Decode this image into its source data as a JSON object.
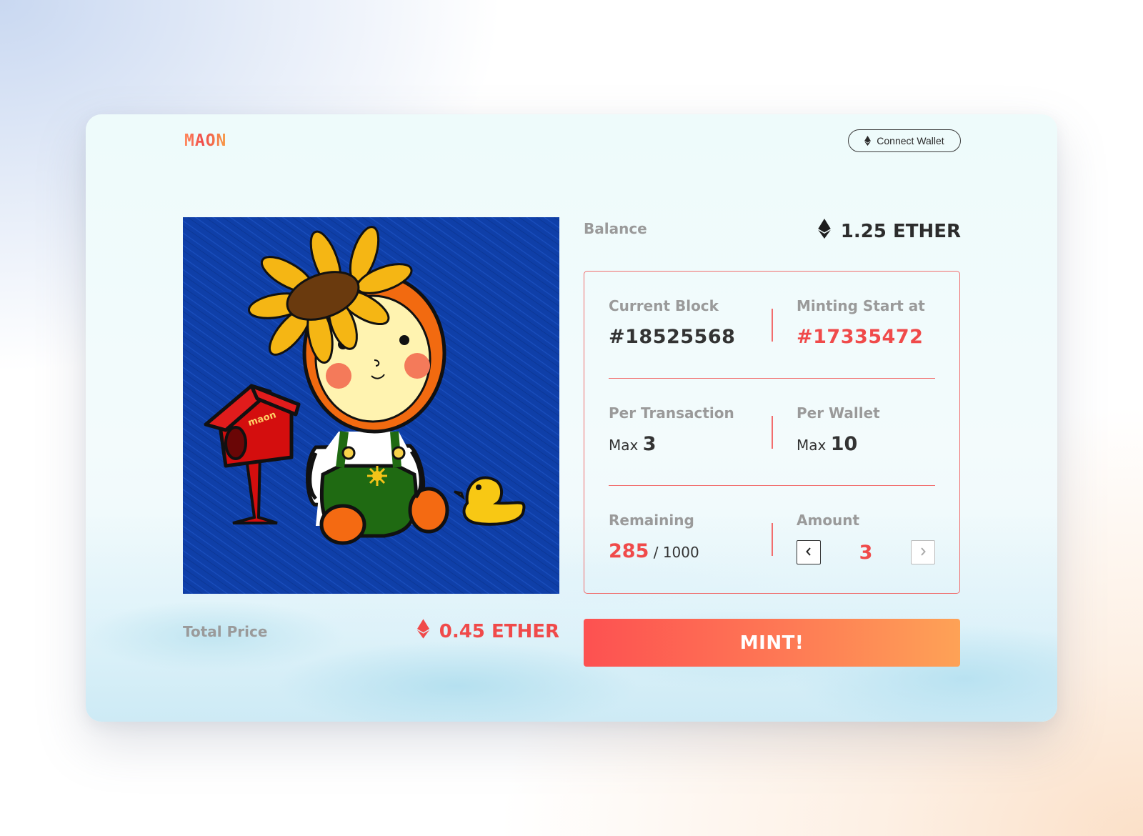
{
  "app": {
    "logo": "MAON"
  },
  "header": {
    "connect_wallet_label": "Connect Wallet",
    "connect_wallet_icon": "ethereum-icon"
  },
  "balance": {
    "label": "Balance",
    "value": "1.25 ETHER",
    "icon": "ethereum-icon"
  },
  "stats": {
    "current_block": {
      "label": "Current Block",
      "value": "#18525568"
    },
    "minting_start": {
      "label": "Minting Start at",
      "value": "#17335472"
    },
    "per_transaction": {
      "label": "Per Transaction",
      "prefix": "Max",
      "value": "3"
    },
    "per_wallet": {
      "label": "Per Wallet",
      "prefix": "Max",
      "value": "10"
    },
    "remaining": {
      "label": "Remaining",
      "value": "285",
      "total": "/ 1000"
    },
    "amount": {
      "label": "Amount",
      "value": "3",
      "decrement_icon": "chevron-left-icon",
      "increment_icon": "chevron-right-icon"
    }
  },
  "total": {
    "label": "Total Price",
    "value": "0.45 ETHER",
    "icon": "ethereum-icon"
  },
  "mint_button": {
    "label": "MINT!"
  },
  "nft_image": {
    "logo_text": "maon"
  },
  "colors": {
    "accent_red": "#f04a4a",
    "mint_gradient_start": "#fd5151",
    "mint_gradient_end": "#fea256",
    "image_background": "#0f3fa8"
  }
}
